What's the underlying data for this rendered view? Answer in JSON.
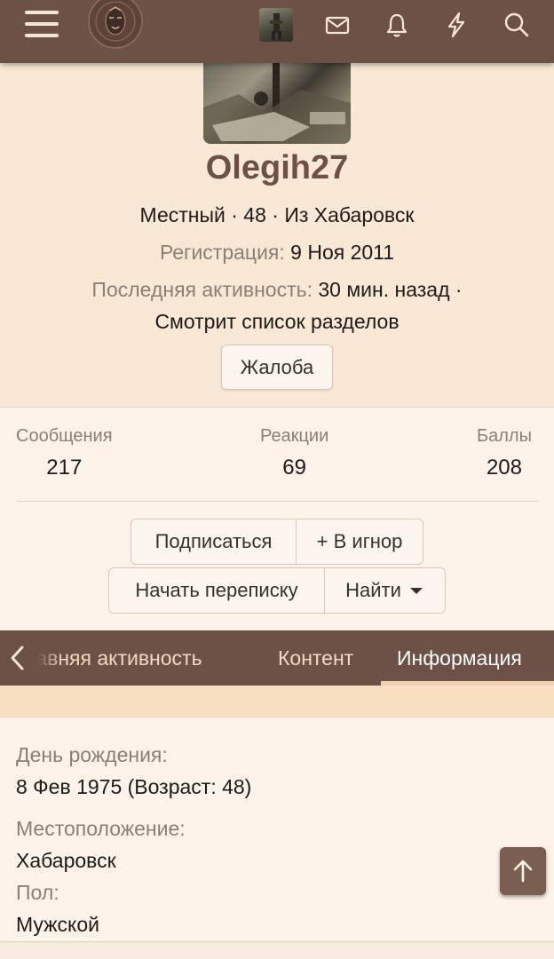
{
  "header": {
    "icons": [
      "menu-icon",
      "logo-seal",
      "user-avatar",
      "mail-icon",
      "bell-icon",
      "lightning-icon",
      "search-icon"
    ]
  },
  "profile": {
    "username": "Olegih27",
    "title_line": "Местный · 48 · Из Хабаровск",
    "registration_label": "Регистрация:",
    "registration_value": "9 Ноя 2011",
    "activity_label": "Последняя активность:",
    "activity_value": "30 мин. назад ·",
    "activity_detail": "Смотрит список разделов",
    "report_label": "Жалоба"
  },
  "stats": [
    {
      "label": "Сообщения",
      "value": "217"
    },
    {
      "label": "Реакции",
      "value": "69"
    },
    {
      "label": "Баллы",
      "value": "208"
    }
  ],
  "actions": {
    "follow": "Подписаться",
    "ignore": "+ В игнор",
    "start_conversation": "Начать переписку",
    "find": "Найти"
  },
  "tabs": [
    {
      "label": "Недавняя активность",
      "active": false
    },
    {
      "label": "Контент",
      "active": false
    },
    {
      "label": "Информация",
      "active": true
    }
  ],
  "info": {
    "birthday_label": "День рождения:",
    "birthday_value": "8 Фев 1975 (Возраст: 48)",
    "location_label": "Местоположение:",
    "location_value": "Хабаровск",
    "gender_label": "Пол:",
    "gender_value": "Мужской"
  },
  "colors": {
    "accent": "#6e5146",
    "header_bg": "#f9e8d6",
    "page_bg": "#fdf3ea",
    "muted_text": "#8a7f77"
  }
}
